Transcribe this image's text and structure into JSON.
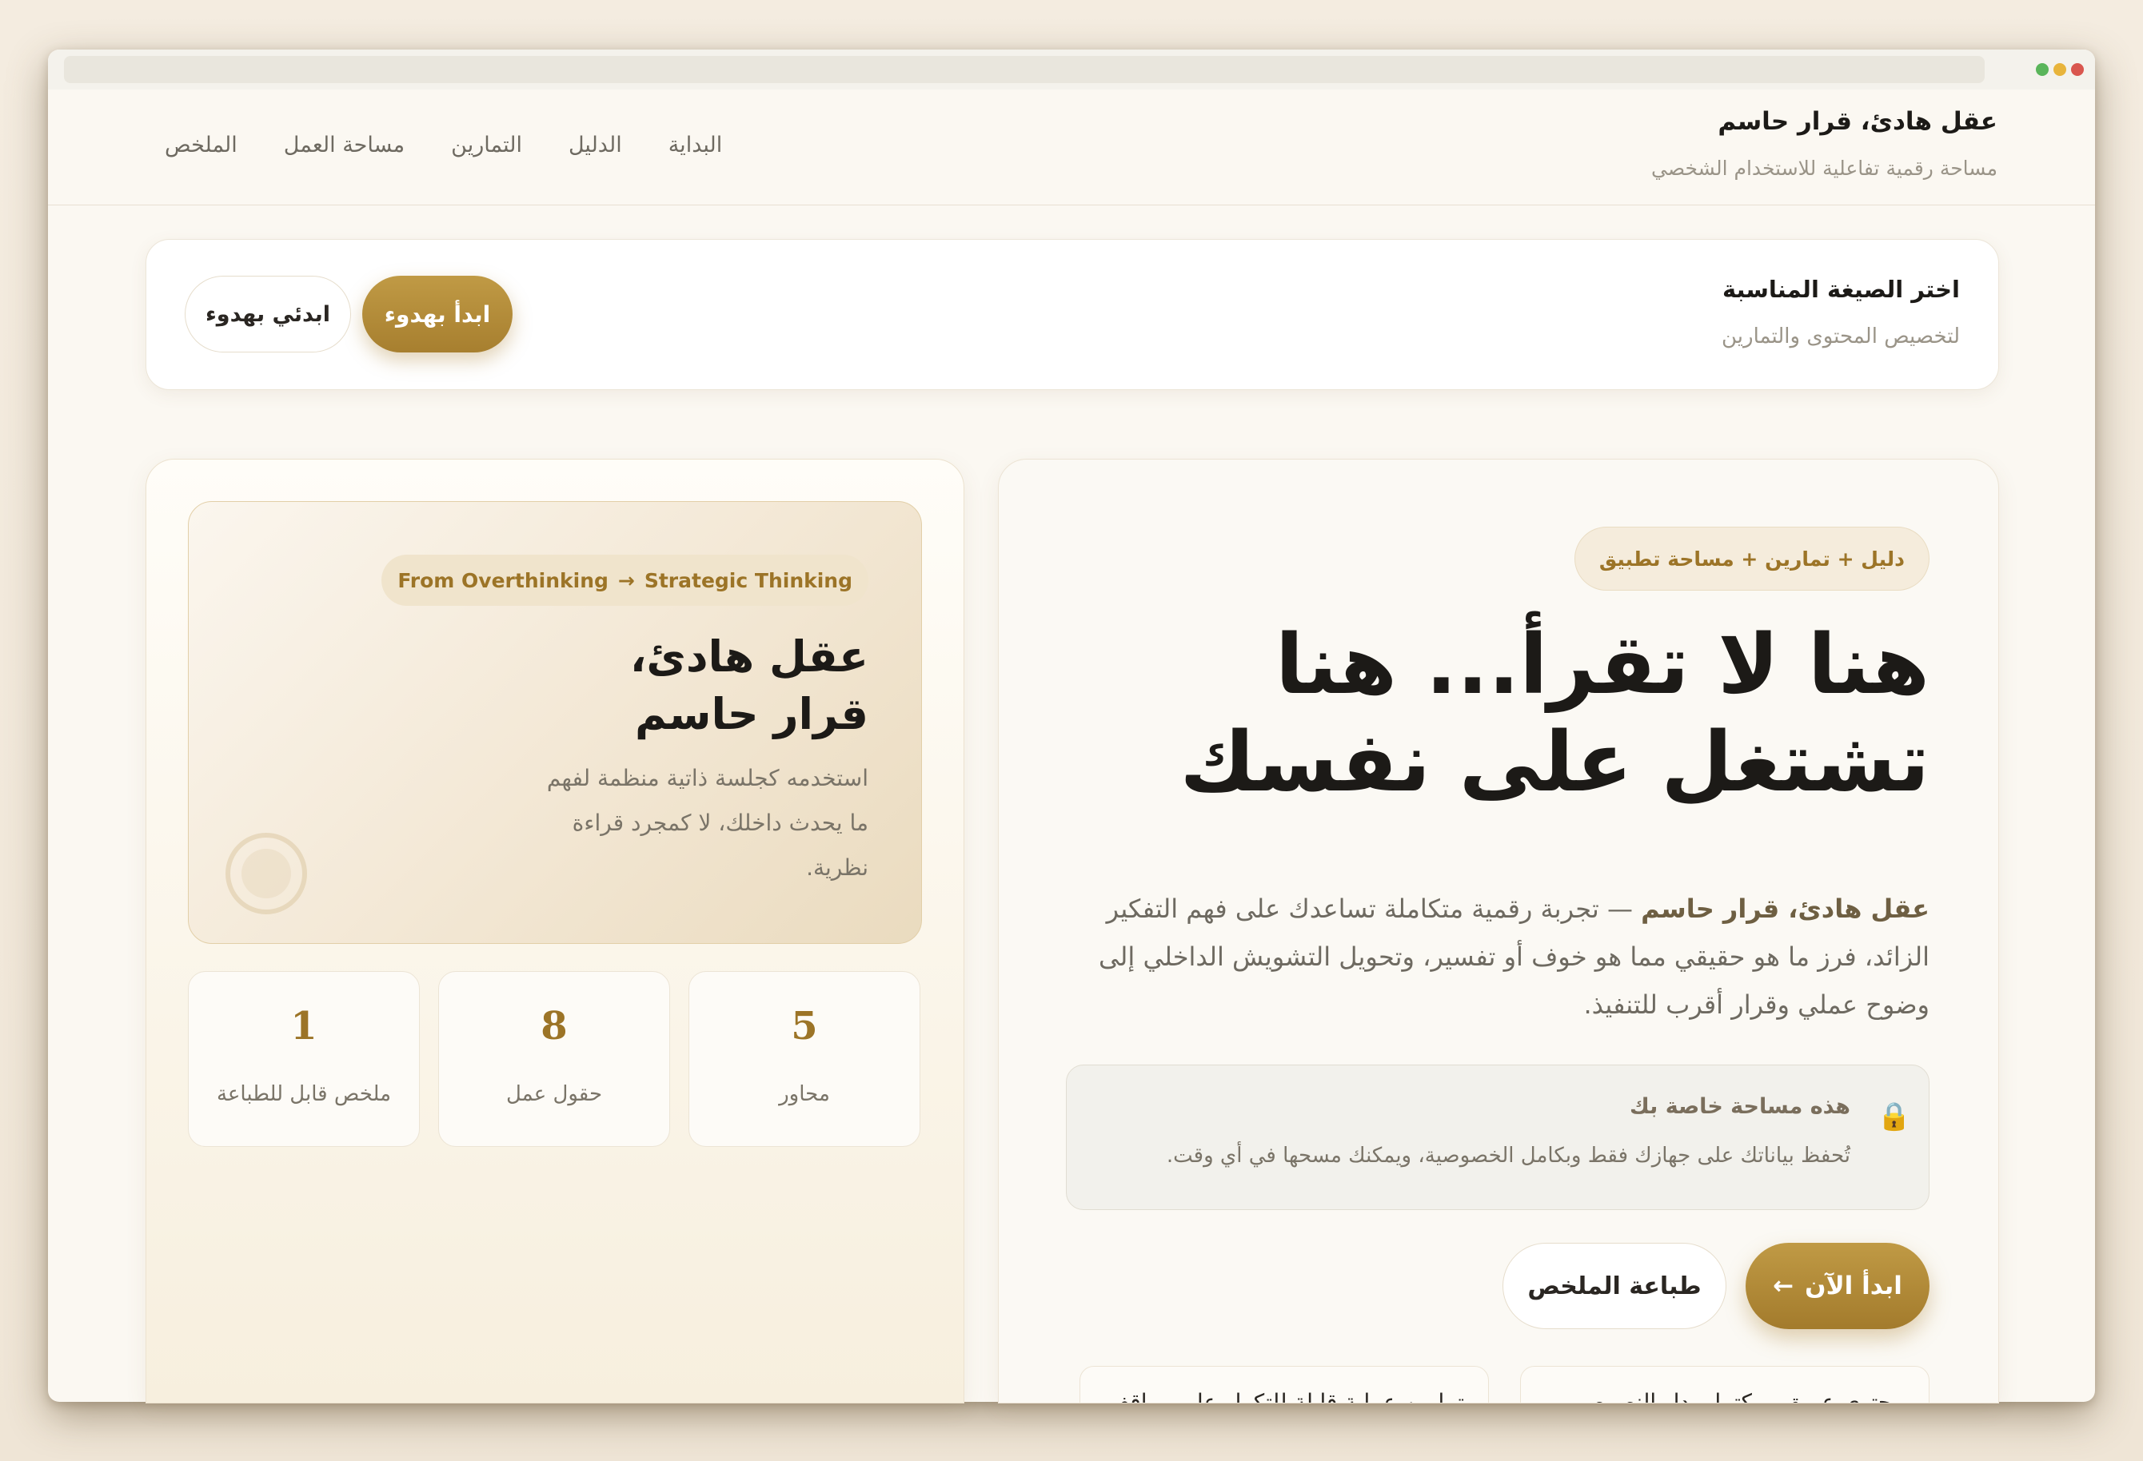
{
  "brand": {
    "title": "عقل هادئ، قرار حاسم",
    "subtitle": "مساحة رقمية تفاعلية للاستخدام الشخصي"
  },
  "nav": {
    "items": [
      "البداية",
      "الدليل",
      "التمارين",
      "مساحة العمل",
      "الملخص"
    ]
  },
  "form_panel": {
    "title": "اختر الصيغة المناسبة",
    "subtitle": "لتخصيص المحتوى والتمارين",
    "male_button": "ابدأ بهدوء",
    "female_button": "ابدئي بهدوء"
  },
  "main": {
    "pill": "دليل + تمارين + مساحة تطبيق",
    "headline": "هنا لا تقرأ... هنا تشتغل على نفسك",
    "lead_bold": "عقل هادئ، قرار حاسم",
    "lead_rest": " — تجربة رقمية متكاملة تساعدك على فهم التفكير الزائد، فرز ما هو حقيقي مما هو خوف أو تفسير، وتحويل التشويش الداخلي إلى وضوح عملي وقرار أقرب للتنفيذ.",
    "privacy": {
      "title": "هذه مساحة خاصة بك",
      "text": "تُحفظ بياناتك على جهازك فقط وبكامل الخصوصية، ويمكنك مسحها في أي وقت."
    },
    "start_button": "ابدأ الآن",
    "start_arrow": "←",
    "print_button": "طباعة الملخص",
    "features": [
      "محتوى عميق ومكتمل بدل النصوص التسويقية المختصرة",
      "تمارين عملية قابلة للتكرار على مواقف الحياة والعمل"
    ]
  },
  "side": {
    "pill_from": "From Overthinking",
    "pill_arrow": "→",
    "pill_to": "Strategic Thinking",
    "title_line1": "عقل هادئ،",
    "title_line2": "قرار حاسم",
    "text": "استخدمه كجلسة ذاتية منظمة لفهم ما يحدث داخلك، لا كمجرد قراءة نظرية.",
    "stats": [
      {
        "value": "5",
        "label": "محاور"
      },
      {
        "value": "8",
        "label": "حقول عمل"
      },
      {
        "value": "1",
        "label": "ملخص قابل للطباعة"
      }
    ]
  },
  "colors": {
    "accent": "#a77f2f",
    "background": "#f4ece0",
    "text": "#1c1a17"
  }
}
